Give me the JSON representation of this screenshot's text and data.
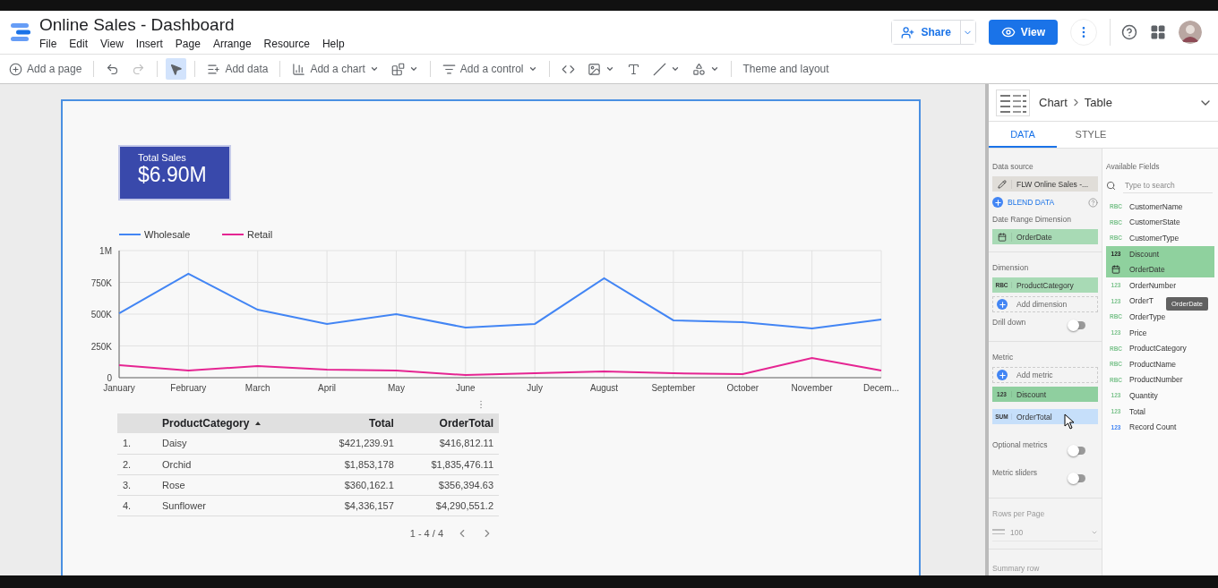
{
  "app": {
    "title": "Online Sales - Dashboard",
    "menu": [
      "File",
      "Edit",
      "View",
      "Insert",
      "Page",
      "Arrange",
      "Resource",
      "Help"
    ]
  },
  "header_actions": {
    "share": "Share",
    "view": "View"
  },
  "toolbar": [
    {
      "kind": "add-page",
      "label": "Add a page"
    },
    {
      "kind": "undo",
      "separator": true,
      "disabled": false
    },
    {
      "kind": "redo",
      "disabled": true
    },
    {
      "kind": "select",
      "separator": true,
      "selected": true
    },
    {
      "kind": "add-data",
      "separator": true,
      "label": "Add data"
    },
    {
      "kind": "add-chart",
      "separator": true,
      "label": "Add a chart",
      "dropdown": true
    },
    {
      "kind": "community",
      "dropdown": true
    },
    {
      "kind": "add-control",
      "separator": true,
      "label": "Add a control",
      "dropdown": true
    },
    {
      "kind": "embed",
      "separator": true
    },
    {
      "kind": "image",
      "dropdown": true
    },
    {
      "kind": "text"
    },
    {
      "kind": "line",
      "dropdown": true
    },
    {
      "kind": "shape",
      "dropdown": true
    },
    {
      "kind": "theme",
      "separator": true,
      "label": "Theme and layout"
    }
  ],
  "scorecard": {
    "label": "Total Sales",
    "value": "$6.90M"
  },
  "line_chart": {
    "chart_data": {
      "type": "line",
      "grid": true,
      "legend": "top",
      "categories": [
        "January",
        "February",
        "March",
        "April",
        "May",
        "June",
        "July",
        "August",
        "September",
        "October",
        "November",
        "Decem..."
      ],
      "series": [
        {
          "name": "Wholesale",
          "color": "#4285f4",
          "values": [
            507000,
            817000,
            535000,
            423000,
            500000,
            394000,
            423000,
            782000,
            451000,
            437000,
            387000,
            458000
          ]
        },
        {
          "name": "Retail",
          "color": "#e52592",
          "values": [
            99000,
            56000,
            92000,
            63000,
            56000,
            21000,
            35000,
            49000,
            35000,
            28000,
            155000,
            56000
          ]
        }
      ],
      "ylim": [
        0,
        1000000
      ],
      "yticks": [
        {
          "value": 0,
          "label": "0"
        },
        {
          "value": 250000,
          "label": "250K"
        },
        {
          "value": 500000,
          "label": "500K"
        },
        {
          "value": 750000,
          "label": "750K"
        },
        {
          "value": 1000000,
          "label": "1M"
        }
      ]
    }
  },
  "table": {
    "columns": [
      {
        "label": "ProductCategory",
        "sorted": true
      },
      {
        "label": "Total",
        "sorted": false
      },
      {
        "label": "OrderTotal",
        "sorted": false
      }
    ],
    "rows": [
      {
        "index": "1.",
        "cells": [
          "Daisy",
          "$421,239.91",
          "$416,812.11"
        ]
      },
      {
        "index": "2.",
        "cells": [
          "Orchid",
          "$1,853,178",
          "$1,835,476.11"
        ]
      },
      {
        "index": "3.",
        "cells": [
          "Rose",
          "$360,162.1",
          "$356,394.63"
        ]
      },
      {
        "index": "4.",
        "cells": [
          "Sunflower",
          "$4,336,157",
          "$4,290,551.2"
        ]
      }
    ],
    "pagination": "1 - 4 / 4"
  },
  "panel": {
    "breadcrumb": [
      "Chart",
      "Table"
    ],
    "tabs": [
      {
        "label": "DATA",
        "selected": true
      },
      {
        "label": "STYLE",
        "selected": false
      }
    ],
    "data_source": {
      "label": "Data source",
      "value": "FLW Online Sales -...",
      "blend": "BLEND DATA"
    },
    "date_range": {
      "label": "Date Range Dimension",
      "chip": {
        "kind": "date",
        "name": "OrderDate",
        "color": "#a8dab5"
      }
    },
    "dimension": {
      "label": "Dimension",
      "chips": [
        {
          "kind": "text",
          "badge": "RBC",
          "name": "ProductCategory",
          "color": "#a8dab5"
        }
      ],
      "add": "Add dimension"
    },
    "drill_down": {
      "label": "Drill down",
      "on": false
    },
    "metric": {
      "label": "Metric",
      "add": "Add metric",
      "chips": [
        {
          "kind": "number",
          "badge": "123",
          "name": "Discount",
          "color": "#8fcf9f"
        },
        {
          "kind": "number",
          "badge": "SUM",
          "name": "OrderTotal",
          "color": "#c6dffa"
        }
      ]
    },
    "toggles": [
      {
        "label": "Optional metrics",
        "on": false
      },
      {
        "label": "Metric sliders",
        "on": false
      }
    ],
    "rows_per_page": {
      "label": "Rows per Page",
      "value": "100",
      "disabled": true
    },
    "summary_row": {
      "label": "Summary row",
      "disabled": true
    },
    "available": {
      "label": "Available Fields",
      "placeholder": "Type to search",
      "fields": [
        {
          "kind": "text",
          "badge": "RBC",
          "name": "CustomerName",
          "selected": false
        },
        {
          "kind": "text",
          "badge": "RBC",
          "name": "CustomerState",
          "selected": false
        },
        {
          "kind": "text",
          "badge": "RBC",
          "name": "CustomerType",
          "selected": false
        },
        {
          "kind": "number",
          "badge": "123",
          "name": "Discount",
          "selected": true
        },
        {
          "kind": "date",
          "name": "OrderDate",
          "selected": true
        },
        {
          "kind": "number",
          "badge": "123",
          "name": "OrderNumber",
          "selected": false
        },
        {
          "kind": "number",
          "badge": "123",
          "name": "OrderT",
          "selected": false
        },
        {
          "kind": "text",
          "badge": "RBC",
          "name": "OrderType",
          "selected": false
        },
        {
          "kind": "number",
          "badge": "123",
          "name": "Price",
          "selected": false
        },
        {
          "kind": "text",
          "badge": "RBC",
          "name": "ProductCategory",
          "selected": false
        },
        {
          "kind": "text",
          "badge": "RBC",
          "name": "ProductName",
          "selected": false
        },
        {
          "kind": "text",
          "badge": "RBC",
          "name": "ProductNumber",
          "selected": false
        },
        {
          "kind": "number",
          "badge": "123",
          "name": "Quantity",
          "selected": false
        },
        {
          "kind": "number",
          "badge": "123",
          "name": "Total",
          "selected": false
        },
        {
          "kind": "calculated",
          "badge": "123",
          "name": "Record Count",
          "selected": false
        }
      ],
      "tooltip": "OrderDate"
    }
  }
}
